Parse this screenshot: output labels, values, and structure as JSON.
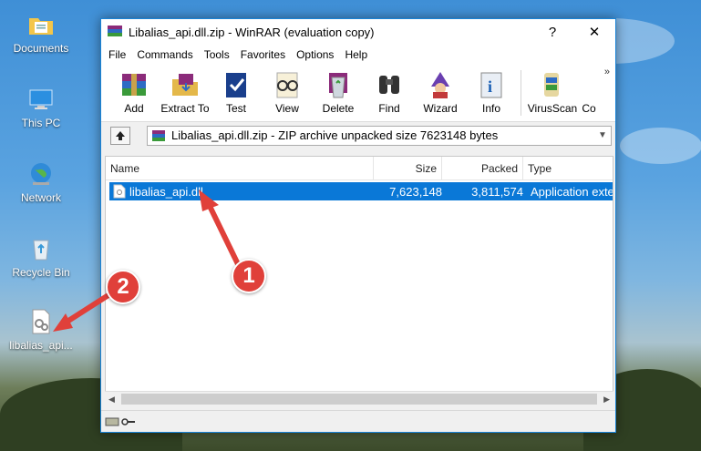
{
  "desktop": {
    "icons": [
      {
        "label": "Documents"
      },
      {
        "label": "This PC"
      },
      {
        "label": "Network"
      },
      {
        "label": "Recycle Bin"
      },
      {
        "label": "libalias_api..."
      }
    ]
  },
  "window": {
    "title": "Libalias_api.dll.zip - WinRAR (evaluation copy)",
    "help_glyph": "?",
    "close_glyph": "✕"
  },
  "menu": [
    "File",
    "Commands",
    "Tools",
    "Favorites",
    "Options",
    "Help"
  ],
  "toolbar": {
    "buttons": [
      "Add",
      "Extract To",
      "Test",
      "View",
      "Delete",
      "Find",
      "Wizard",
      "Info",
      "VirusScan",
      "Co"
    ],
    "more_glyph": "»"
  },
  "pathbar": {
    "text": "Libalias_api.dll.zip - ZIP archive unpacked size 7623148 bytes"
  },
  "list": {
    "columns": [
      "Name",
      "Size",
      "Packed",
      "Type"
    ],
    "rows": [
      {
        "name": "libalias_api.dll",
        "size": "7,623,148",
        "packed": "3,811,574",
        "type": "Application exte"
      }
    ]
  },
  "annotations": {
    "one": "1",
    "two": "2"
  },
  "colors": {
    "accent": "#0a78d7",
    "arrow": "#e0403a"
  }
}
